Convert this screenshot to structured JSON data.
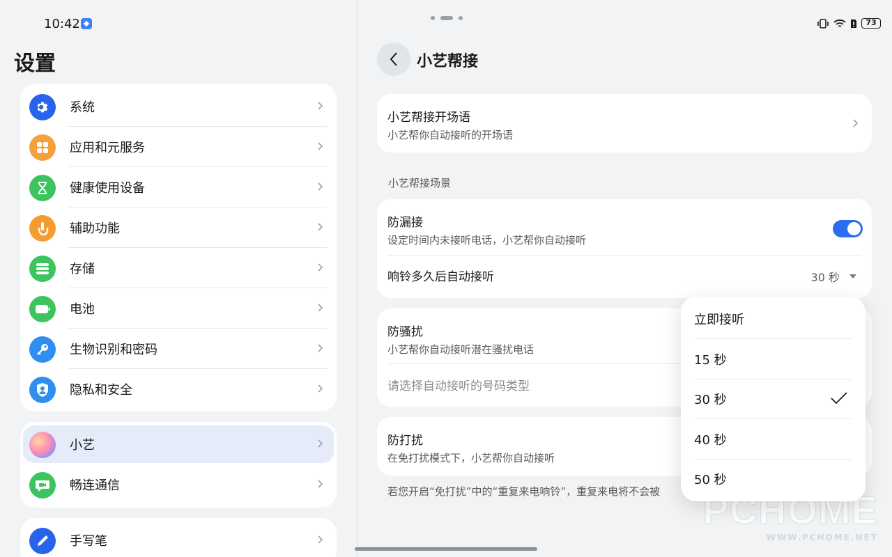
{
  "status_left": {
    "time": "10:42"
  },
  "status_right": {
    "battery": "73"
  },
  "left": {
    "title": "设置",
    "group1": [
      {
        "label": "系统",
        "icon": "gear-icon",
        "color": "#2763eb"
      },
      {
        "label": "应用和元服务",
        "icon": "apps-grid-icon",
        "color": "#f5a03a"
      },
      {
        "label": "健康使用设备",
        "icon": "hourglass-icon",
        "color": "#3cc45e"
      },
      {
        "label": "辅助功能",
        "icon": "hand-tap-icon",
        "color": "#f59c31"
      },
      {
        "label": "存储",
        "icon": "storage-icon",
        "color": "#3cc45e"
      },
      {
        "label": "电池",
        "icon": "battery-icon",
        "color": "#3cc45e"
      },
      {
        "label": "生物识别和密码",
        "icon": "key-icon",
        "color": "#2f8ef0"
      },
      {
        "label": "隐私和安全",
        "icon": "privacy-shield-icon",
        "color": "#2f8ef0"
      }
    ],
    "group2": [
      {
        "label": "小艺",
        "icon": "xiaoyi-orb-icon",
        "color": "#ff8fb4",
        "selected": true
      },
      {
        "label": "畅连通信",
        "icon": "video-call-icon",
        "color": "#3cc45e"
      }
    ],
    "group3": [
      {
        "label": "手写笔",
        "icon": "stylus-icon",
        "color": "#2763eb"
      }
    ]
  },
  "right": {
    "title": "小艺帮接",
    "opening": {
      "title": "小艺帮接开场语",
      "subtitle": "小艺帮你自动接听的开场语"
    },
    "section_label": "小艺帮接场景",
    "missed": {
      "title": "防漏接",
      "subtitle": "设定时间内未接听电话，小艺帮你自动接听",
      "toggle_on": true,
      "delay_label": "响铃多久后自动接听",
      "delay_value": "30 秒"
    },
    "harass": {
      "title": "防骚扰",
      "subtitle": "小艺帮你自动接听潜在骚扰电话",
      "select_label": "请选择自动接听的号码类型"
    },
    "dnd": {
      "title": "防打扰",
      "subtitle": "在免打扰模式下，小艺帮你自动接听"
    },
    "footnote": "若您开启“免打扰”中的“重复来电响铃”，重复来电将不会被"
  },
  "dropdown": {
    "options": [
      "立即接听",
      "15 秒",
      "30 秒",
      "40 秒",
      "50 秒"
    ],
    "selected": "30 秒"
  },
  "watermark": {
    "big": "PCHOME",
    "small": "WWW.PCHOME.NET"
  },
  "colors": {
    "accent": "#2b6cf0",
    "selected_bg": "#e6ebfa"
  }
}
